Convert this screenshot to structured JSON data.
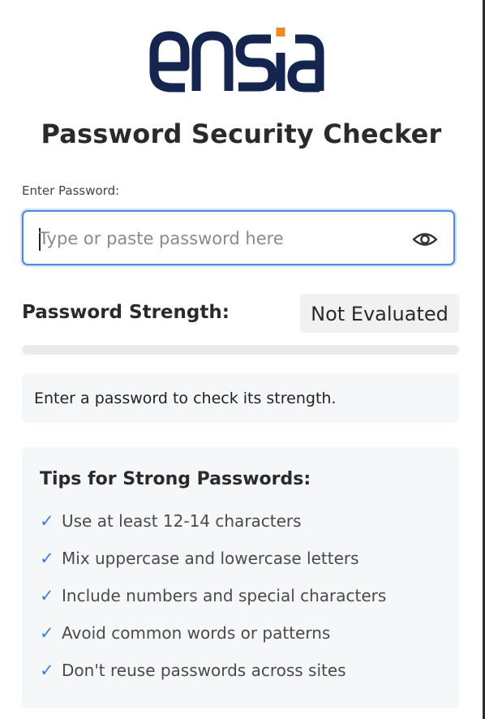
{
  "brand": {
    "logo_text": "ensia",
    "colors": {
      "navy": "#14254f",
      "accent": "#f0891f"
    }
  },
  "header": {
    "title": "Password Security Checker"
  },
  "password_field": {
    "label": "Enter Password:",
    "value": "",
    "placeholder": "Type or paste password here",
    "toggle_icon": "eye-icon",
    "focus_color": "#4a8be0"
  },
  "strength": {
    "label": "Password Strength:",
    "status": "Not Evaluated",
    "meter_fraction": 0
  },
  "feedback": {
    "message": "Enter a password to check its strength."
  },
  "tips": {
    "title": "Tips for Strong Passwords:",
    "check_icon": "checkmark-icon",
    "check_glyph": "✓",
    "check_color": "#3b7de0",
    "items": [
      "Use at least 12-14 characters",
      "Mix uppercase and lowercase letters",
      "Include numbers and special characters",
      "Avoid common words or patterns",
      "Don't reuse passwords across sites"
    ]
  }
}
